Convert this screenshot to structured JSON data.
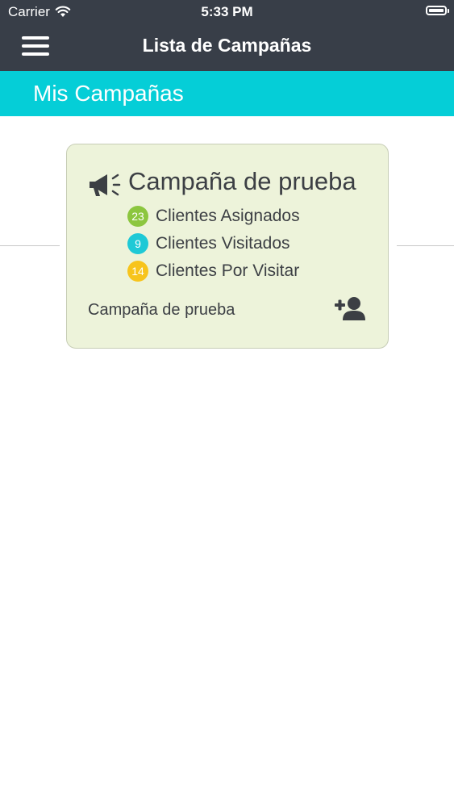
{
  "status_bar": {
    "carrier": "Carrier",
    "time": "5:33 PM"
  },
  "header": {
    "title": "Lista de Campañas",
    "menu_icon": "hamburger-menu-icon"
  },
  "section": {
    "title": "Mis Campañas"
  },
  "campaign_card": {
    "title": "Campaña de prueba",
    "icon": "megaphone-icon",
    "stats": [
      {
        "count": "23",
        "label": "Clientes Asignados",
        "color": "#8cc63f"
      },
      {
        "count": "9",
        "label": "Clientes Visitados",
        "color": "#1ec9d6"
      },
      {
        "count": "14",
        "label": "Clientes Por Visitar",
        "color": "#f7c41c"
      }
    ],
    "footer_text": "Campaña de prueba",
    "action_icon": "add-user-icon"
  },
  "colors": {
    "header_bg": "#383e48",
    "section_bg": "#05ced7",
    "card_bg": "#edf3da",
    "text_dark": "#3c3f44"
  }
}
